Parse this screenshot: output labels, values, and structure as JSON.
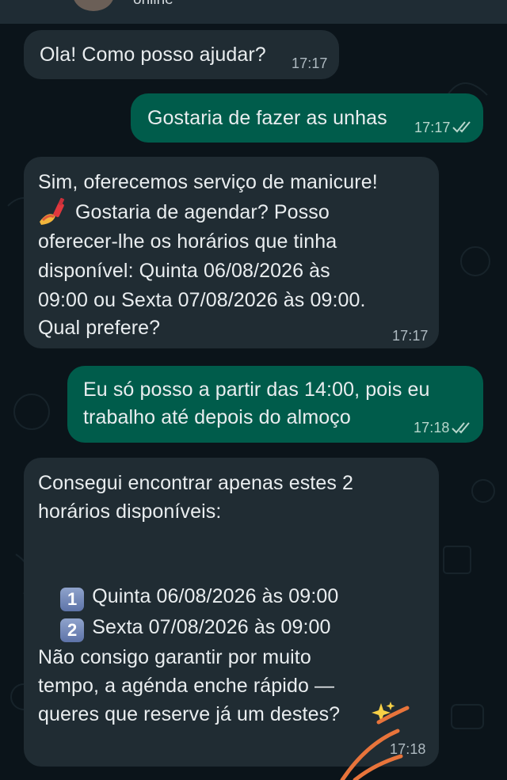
{
  "header": {
    "status": "online"
  },
  "messages": [
    {
      "id": "m1",
      "direction": "incoming",
      "lines": [
        "Ola! Como posso ajudar?"
      ],
      "time": "17:17"
    },
    {
      "id": "m2",
      "direction": "outgoing",
      "lines": [
        "Gostaria de fazer as unhas"
      ],
      "time": "17:17",
      "read": true
    },
    {
      "id": "m3",
      "direction": "incoming",
      "lines": [
        "Sim, oferecemos serviço de manicure!",
        "Gostaria de agendar? Posso",
        "oferecer-lhe os horários que tinha",
        "disponível: Quinta 06/08/2026 às",
        "09:00 ou Sexta 07/08/2026 às 09:00.",
        "Qual prefere?"
      ],
      "emoji": "nail-polish-emoji",
      "time": "17:17"
    },
    {
      "id": "m4",
      "direction": "outgoing",
      "lines": [
        "Eu só posso a partir das 14:00, pois eu",
        "trabalho até depois do almoço"
      ],
      "time": "17:18",
      "read": true
    },
    {
      "id": "m5",
      "direction": "incoming",
      "lines": [
        "Consegui encontrar apenas estes 2",
        "horários disponíveis:",
        "Não consigo garantir por muito",
        "tempo, a agénda enche rápido —",
        "queres que reserve já um destes?"
      ],
      "options": [
        {
          "key": "1",
          "text": "Quinta 06/08/2026 às 09:00"
        },
        {
          "key": "2",
          "text": "Sexta 07/08/2026 às 09:00"
        }
      ],
      "emoji": "sparkles-emoji",
      "time": "17:18"
    }
  ],
  "colors": {
    "background": "#0b141a",
    "incoming_bubble": "#202c33",
    "outgoing_bubble": "#005c4b",
    "annotation_stroke": "#e8743b"
  }
}
